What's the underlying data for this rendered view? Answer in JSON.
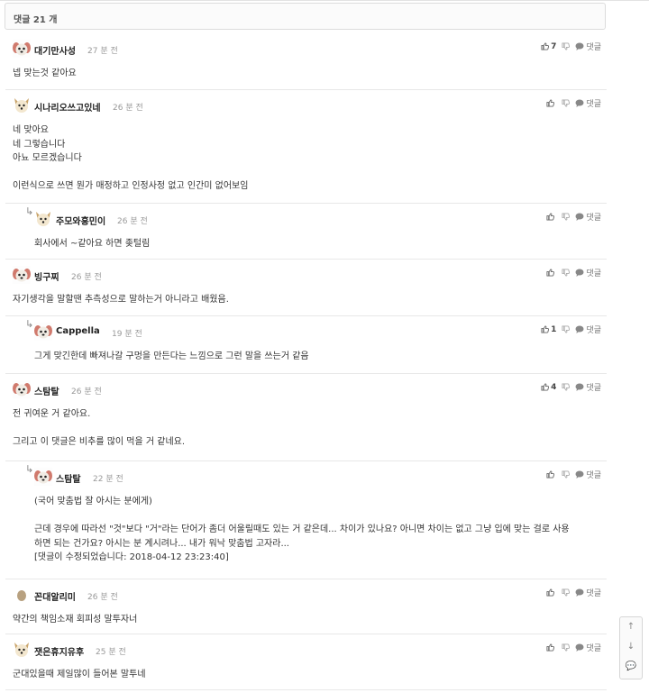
{
  "header": {
    "title": "댓글 21 개"
  },
  "reply_label": "댓글",
  "comments": [
    {
      "name": "대기만사성",
      "time": "27 분 전",
      "avatar": "dog-avatar",
      "likes": "7",
      "nested": false,
      "lines": [
        "넵 맞는것 같아요"
      ]
    },
    {
      "name": "시나리오쓰고있네",
      "time": "26 분 전",
      "avatar": "fox-avatar",
      "likes": "",
      "nested": false,
      "lines": [
        "네 맞아요",
        "네 그렇습니다",
        "아뇨 모르겠습니다",
        "",
        "이런식으로 쓰면 뭔가 매정하고 인정사정 없고 인간미 없어보임"
      ]
    },
    {
      "name": "주모와흥민이",
      "time": "26 분 전",
      "avatar": "fox-avatar",
      "likes": "",
      "nested": true,
      "lines": [
        "회사에서 ~같아요 하면 좆털림"
      ]
    },
    {
      "name": "빙구찌",
      "time": "26 분 전",
      "avatar": "dog-avatar",
      "likes": "",
      "nested": false,
      "lines": [
        "자기생각을 말할땐 추측성으로 말하는거 아니라고 배웠음."
      ]
    },
    {
      "name": "Cappella",
      "time": "19 분 전",
      "avatar": "dog-avatar",
      "likes": "1",
      "nested": true,
      "lines": [
        "그게 맞긴한데 빠져나갈 구멍을 만든다는 느낌으로 그런 말을 쓰는거 같음"
      ]
    },
    {
      "name": "스탐탈",
      "time": "26 분 전",
      "avatar": "dog-avatar",
      "likes": "4",
      "nested": false,
      "lines": [
        "전 귀여운 거 같아요.",
        "",
        "그리고 이 댓글은 비추를 많이 먹을 거 같네요."
      ]
    },
    {
      "name": "스탐탈",
      "time": "22 분 전",
      "avatar": "dog-avatar",
      "likes": "",
      "nested": true,
      "lines": [
        "(국어 맞춤법 잘 아시는 분에게)",
        "",
        "근데 경우에 따라선 \"것\"보다 \"거\"라는 단어가 좀더 어울릴때도 있는 거 같은데... 차이가 있나요? 아니면 차이는 없고 그냥 입에 맞는 걸로 사용",
        "하면 되는 건가요? 아시는 분 계시려나... 내가 워낙 맞춤법 고자라...",
        "[댓글이 수정되었습니다: 2018-04-12 23:23:40]"
      ]
    },
    {
      "name": "꼰대알리미",
      "time": "26 분 전",
      "avatar": "dot-avatar",
      "likes": "",
      "nested": false,
      "lines": [
        "약간의 책임소재 회피성 말투자너"
      ]
    },
    {
      "name": "잿은휴지유후",
      "time": "25 분 전",
      "avatar": "fox-avatar",
      "likes": "",
      "nested": false,
      "lines": [
        "군대있을때 제일많이 들어본 말투네"
      ]
    }
  ],
  "side": {
    "up": "↑",
    "down": "↓",
    "chat": "💬"
  }
}
